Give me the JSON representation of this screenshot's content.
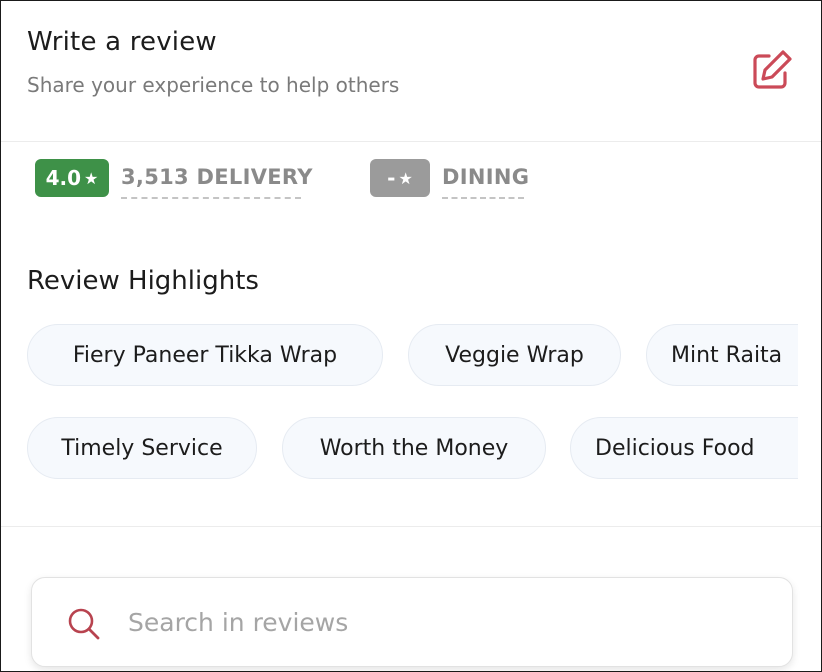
{
  "header": {
    "title": "Write a review",
    "subtitle": "Share your experience to help others",
    "edit_icon": "edit-pencil-icon",
    "accent_color": "#cb4a58"
  },
  "ratings": {
    "delivery": {
      "score": "4.0",
      "star": "★",
      "label": "3,513 DELIVERY",
      "badge_color": "#3e9148"
    },
    "dining": {
      "score": "-",
      "star": "★",
      "label": "DINING",
      "badge_color": "#9b9b9b"
    }
  },
  "highlights": {
    "title": "Review Highlights",
    "rows": [
      [
        "Fiery Paneer Tikka Wrap",
        "Veggie Wrap",
        "Mint Raita"
      ],
      [
        "Timely Service",
        "Worth the Money",
        "Delicious Food"
      ]
    ]
  },
  "search": {
    "placeholder": "Search in reviews",
    "value": "",
    "icon": "search-icon",
    "icon_color": "#b8434f"
  }
}
